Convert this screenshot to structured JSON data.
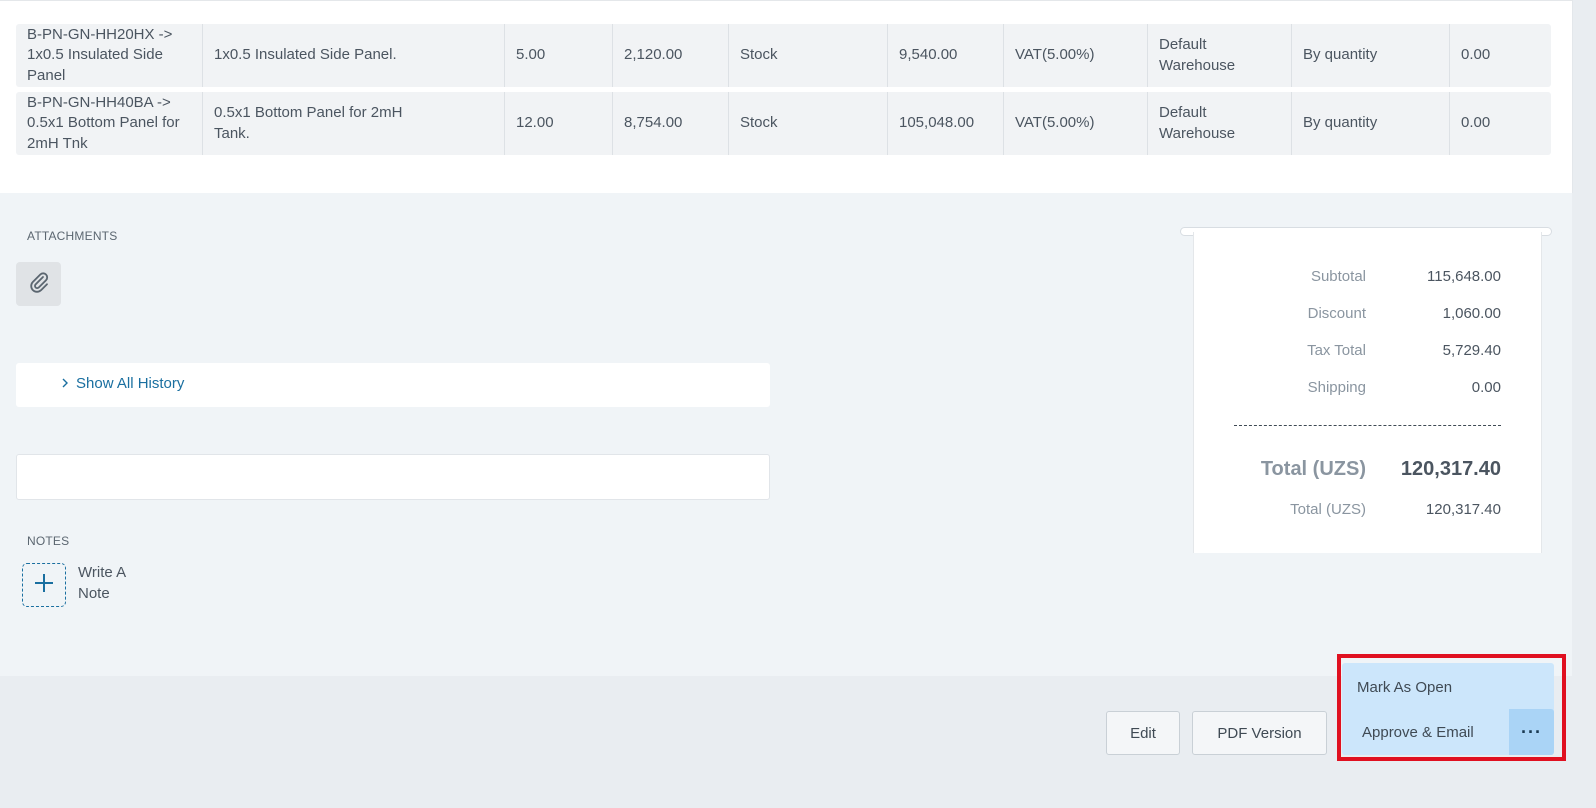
{
  "table": {
    "rows": [
      {
        "item": "B-PN-GN-HH20HX -> 1x0.5 Insulated Side Panel",
        "description": "1x0.5 Insulated Side Panel.",
        "quantity": "5.00",
        "rate": "2,120.00",
        "type": "Stock",
        "amount": "9,540.00",
        "tax": "VAT(5.00%)",
        "warehouse": "Default Warehouse",
        "discount_type": "By quantity",
        "discount": "0.00"
      },
      {
        "item": "B-PN-GN-HH40BA -> 0.5x1 Bottom Panel for 2mH Tnk",
        "description": "0.5x1 Bottom Panel for 2mH Tank.",
        "quantity": "12.00",
        "rate": "8,754.00",
        "type": "Stock",
        "amount": "105,048.00",
        "tax": "VAT(5.00%)",
        "warehouse": "Default Warehouse",
        "discount_type": "By quantity",
        "discount": "0.00"
      }
    ]
  },
  "attachments": {
    "label": "ATTACHMENTS",
    "icon": "paperclip-icon"
  },
  "history": {
    "link_label": "Show All History",
    "icon": "chevron-right-icon"
  },
  "notes": {
    "label": "NOTES",
    "add_label": "Write A Note",
    "icon": "plus-icon"
  },
  "summary": {
    "subtotal_label": "Subtotal",
    "subtotal_value": "115,648.00",
    "discount_label": "Discount",
    "discount_value": "1,060.00",
    "tax_label": "Tax Total",
    "tax_value": "5,729.40",
    "shipping_label": "Shipping",
    "shipping_value": "0.00",
    "total_label": "Total (UZS)",
    "total_value": "120,317.40",
    "total2_label": "Total (UZS)",
    "total2_value": "120,317.40"
  },
  "footer": {
    "edit_label": "Edit",
    "pdf_label": "PDF Version",
    "mark_open_label": "Mark As Open",
    "approve_label": "Approve & Email",
    "more_label": "···"
  },
  "colors": {
    "accent": "#1a6fa0",
    "highlight": "#e01020",
    "action_bg": "#cce6fb"
  }
}
